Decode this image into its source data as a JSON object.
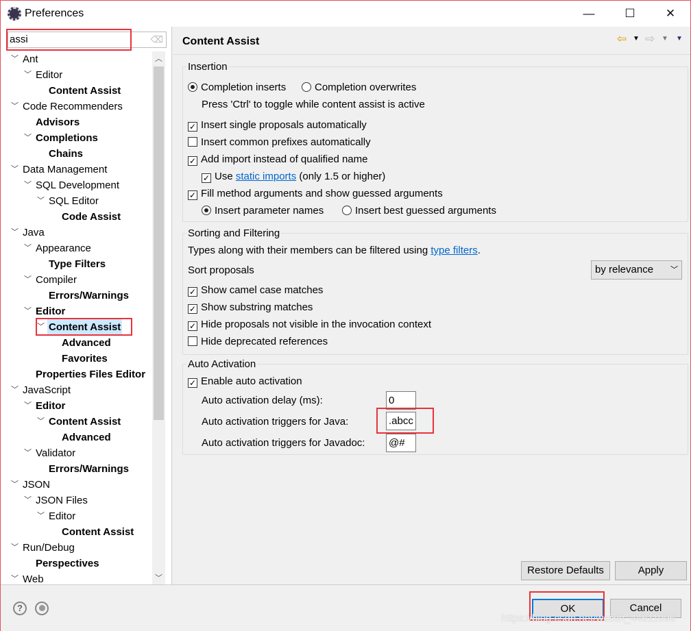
{
  "window": {
    "title": "Preferences",
    "minimize": "—",
    "maximize": "☐",
    "close": "✕"
  },
  "search": {
    "value": "assi"
  },
  "tree": [
    {
      "label": "Ant",
      "level": 0,
      "expanded": true,
      "bold": false
    },
    {
      "label": "Editor",
      "level": 1,
      "expanded": true,
      "bold": false
    },
    {
      "label": "Content Assist",
      "level": 2,
      "bold": true
    },
    {
      "label": "Code Recommenders",
      "level": 0,
      "expanded": true,
      "bold": false
    },
    {
      "label": "Advisors",
      "level": 1,
      "bold": true
    },
    {
      "label": "Completions",
      "level": 1,
      "expanded": true,
      "bold": true
    },
    {
      "label": "Chains",
      "level": 2,
      "bold": true
    },
    {
      "label": "Data Management",
      "level": 0,
      "expanded": true,
      "bold": false
    },
    {
      "label": "SQL Development",
      "level": 1,
      "expanded": true,
      "bold": false
    },
    {
      "label": "SQL Editor",
      "level": 2,
      "expanded": true,
      "bold": false
    },
    {
      "label": "Code Assist",
      "level": 3,
      "bold": true
    },
    {
      "label": "Java",
      "level": 0,
      "expanded": true,
      "bold": false
    },
    {
      "label": "Appearance",
      "level": 1,
      "expanded": true,
      "bold": false
    },
    {
      "label": "Type Filters",
      "level": 2,
      "bold": true
    },
    {
      "label": "Compiler",
      "level": 1,
      "expanded": true,
      "bold": false
    },
    {
      "label": "Errors/Warnings",
      "level": 2,
      "bold": true
    },
    {
      "label": "Editor",
      "level": 1,
      "expanded": true,
      "bold": true
    },
    {
      "label": "Content Assist",
      "level": 2,
      "expanded": true,
      "bold": true,
      "selected": true
    },
    {
      "label": "Advanced",
      "level": 3,
      "bold": true
    },
    {
      "label": "Favorites",
      "level": 3,
      "bold": true
    },
    {
      "label": "Properties Files Editor",
      "level": 1,
      "bold": true
    },
    {
      "label": "JavaScript",
      "level": 0,
      "expanded": true,
      "bold": false
    },
    {
      "label": "Editor",
      "level": 1,
      "expanded": true,
      "bold": true
    },
    {
      "label": "Content Assist",
      "level": 2,
      "expanded": true,
      "bold": true
    },
    {
      "label": "Advanced",
      "level": 3,
      "bold": true
    },
    {
      "label": "Validator",
      "level": 1,
      "expanded": true,
      "bold": false
    },
    {
      "label": "Errors/Warnings",
      "level": 2,
      "bold": true
    },
    {
      "label": "JSON",
      "level": 0,
      "expanded": true,
      "bold": false
    },
    {
      "label": "JSON Files",
      "level": 1,
      "expanded": true,
      "bold": false
    },
    {
      "label": "Editor",
      "level": 2,
      "expanded": true,
      "bold": false
    },
    {
      "label": "Content Assist",
      "level": 3,
      "bold": true
    },
    {
      "label": "Run/Debug",
      "level": 0,
      "expanded": true,
      "bold": false
    },
    {
      "label": "Perspectives",
      "level": 1,
      "bold": true
    },
    {
      "label": "Web",
      "level": 0,
      "expanded": true,
      "bold": false
    }
  ],
  "page": {
    "title": "Content Assist",
    "insertion": {
      "label": "Insertion",
      "completion_inserts": "Completion inserts",
      "completion_overwrites": "Completion overwrites",
      "toggle_hint": "Press 'Ctrl' to toggle while content assist is active",
      "single_proposals": "Insert single proposals automatically",
      "common_prefixes": "Insert common prefixes automatically",
      "add_import": "Add import instead of qualified name",
      "use": "Use",
      "static_imports": "static imports",
      "static_suffix": "(only 1.5 or higher)",
      "fill_args": "Fill method arguments and show guessed arguments",
      "param_names": "Insert parameter names",
      "best_guessed": "Insert best guessed arguments"
    },
    "sorting": {
      "label": "Sorting and Filtering",
      "desc_prefix": "Types along with their members can be filtered using",
      "type_filters": "type filters",
      "desc_suffix": ".",
      "sort_label": "Sort proposals",
      "sort_value": "by relevance",
      "camel": "Show camel case matches",
      "substring": "Show substring matches",
      "hide_not_visible": "Hide proposals not visible in the invocation context",
      "hide_deprecated": "Hide deprecated references"
    },
    "auto": {
      "label": "Auto Activation",
      "enable": "Enable auto activation",
      "delay_label": "Auto activation delay (ms):",
      "delay_value": "0",
      "java_label": "Auto activation triggers for Java:",
      "java_value": ".abcc",
      "javadoc_label": "Auto activation triggers for Javadoc:",
      "javadoc_value": "@#"
    },
    "restore_defaults": "Restore Defaults",
    "apply": "Apply"
  },
  "footer": {
    "ok": "OK",
    "cancel": "Cancel",
    "help": "?"
  },
  "watermark": "https://blog.csdn.net/weixin_44611096",
  "colors": {
    "highlight": "#e8323a",
    "link": "#0066cc",
    "selection": "#cce8ff"
  }
}
